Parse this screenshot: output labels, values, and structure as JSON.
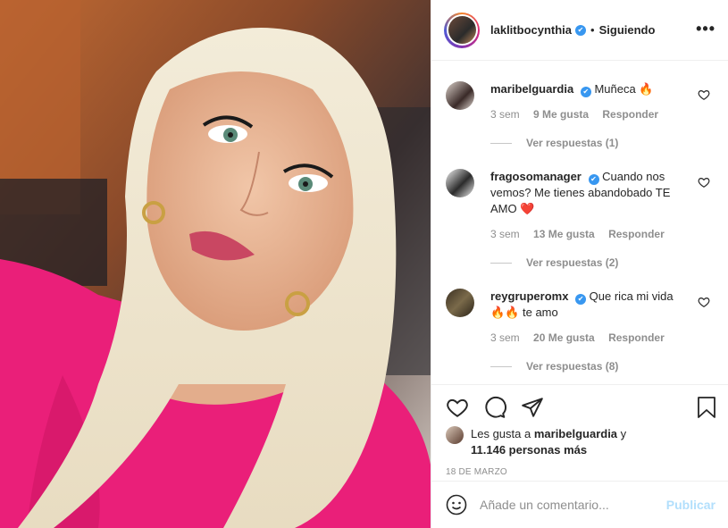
{
  "post": {
    "username": "laklitbocynthia",
    "verified": "✔",
    "separator": "•",
    "follow_status": "Siguiendo",
    "more": "•••"
  },
  "comments": [
    {
      "username": "maribelguardia",
      "verified": "✔",
      "text": "Muñeca 🔥",
      "time": "3 sem",
      "likes": "9 Me gusta",
      "reply": "Responder",
      "view_replies": "Ver respuestas (1)"
    },
    {
      "username": "fragosomanager",
      "verified": "✔",
      "text": "Cuando nos vemos? Me tienes abandobado TE AMO ❤️",
      "time": "3 sem",
      "likes": "13 Me gusta",
      "reply": "Responder",
      "view_replies": "Ver respuestas (2)"
    },
    {
      "username": "reygruperomx",
      "verified": "✔",
      "text": "Que rica mi vida 🔥🔥 te amo",
      "time": "3 sem",
      "likes": "20 Me gusta",
      "reply": "Responder",
      "view_replies": "Ver respuestas (8)"
    }
  ],
  "likes": {
    "prefix": "Les gusta a",
    "user": "maribelguardia",
    "conj": "y",
    "others": "11.146 personas más"
  },
  "date": "18 DE MARZO",
  "comment_box": {
    "placeholder": "Añade un comentario...",
    "post_label": "Publicar"
  },
  "icons": {
    "like": "heart-icon",
    "comment": "comment-icon",
    "share": "share-icon",
    "save": "bookmark-icon",
    "emoji": "emoji-icon"
  },
  "colors": {
    "verified": "#3897f0",
    "publish_disabled": "#b2dffc",
    "secondary_text": "#8e8e8e"
  }
}
